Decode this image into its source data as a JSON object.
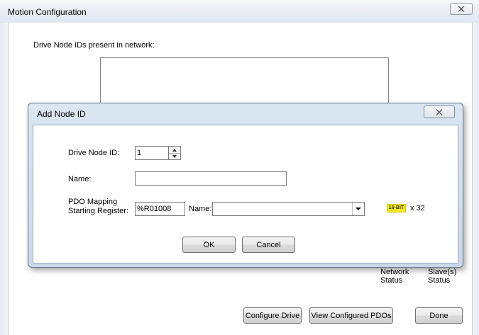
{
  "window": {
    "title": "Motion Configuration",
    "drive_ids_label": "Drive Node IDs present in network:",
    "columns": {
      "network_status": "Network\nStatus",
      "slave_status": "Slave(s)\nStatus"
    },
    "buttons": {
      "configure_drive": "Configure Drive",
      "view_configured_pdos": "View Configured PDOs",
      "done": "Done"
    }
  },
  "dialog": {
    "title": "Add Node ID",
    "fields": {
      "drive_node_id_label": "Drive Node ID:",
      "drive_node_id_value": "1",
      "name_label": "Name:",
      "name_value": "",
      "pdo_label": "PDO Mapping\nStarting Register:",
      "pdo_register_value": "%R01008",
      "pdo_name_label": "Name:",
      "pdo_name_value": ""
    },
    "bit_badge": "16-BIT",
    "bit_count": "x 32",
    "buttons": {
      "ok": "OK",
      "cancel": "Cancel"
    }
  },
  "icons": {
    "close": "close-icon",
    "spin_up": "up-arrow-icon",
    "spin_down": "down-arrow-icon",
    "dropdown": "chevron-down-icon"
  }
}
